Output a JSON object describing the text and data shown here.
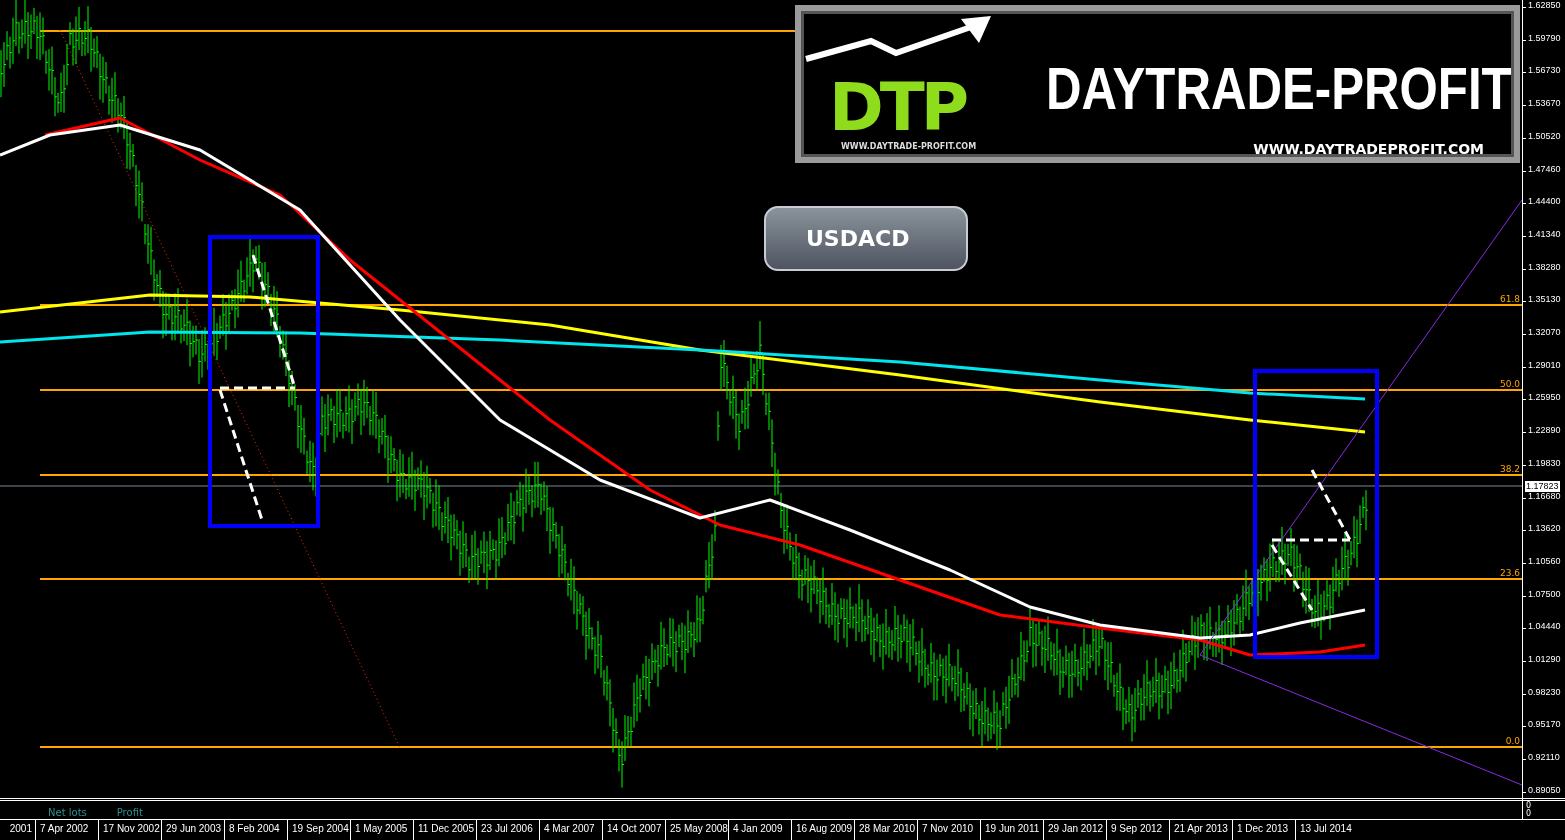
{
  "logo": {
    "monogram": "DTP",
    "brand": "DAYTRADE-PROFIT",
    "url_small": "WWW.DAYTRADE-PROFIT.COM",
    "url_large": "WWW.DAYTRADEPROFIT.COM"
  },
  "symbol_badge": "USDACD",
  "fib_levels": [
    {
      "label": "61.8"
    },
    {
      "label": "50.0"
    },
    {
      "label": "38.2"
    },
    {
      "label": "23.6"
    },
    {
      "label": "0.0"
    }
  ],
  "price_axis": {
    "ticks": [
      "1.62850",
      "1.59790",
      "1.56730",
      "1.53670",
      "1.50520",
      "1.47460",
      "1.44400",
      "1.41340",
      "1.38280",
      "1.35130",
      "1.32070",
      "1.29010",
      "1.25950",
      "1.22890",
      "1.19830",
      "1.16680",
      "1.13620",
      "1.10560",
      "1.07500",
      "1.04440",
      "1.01290",
      "0.98230",
      "0.95170",
      "0.92110",
      "0.89050"
    ],
    "current_price": "1.17823"
  },
  "indicator": {
    "labels": [
      "Net lots",
      "Profit"
    ],
    "values": [
      "0",
      "0"
    ]
  },
  "date_axis": [
    "2001",
    "7 Apr 2002",
    "17 Nov 2002",
    "29 Jun 2003",
    "8 Feb 2004",
    "19 Sep 2004",
    "1 May 2005",
    "11 Dec 2005",
    "23 Jul 2006",
    "4 Mar 2007",
    "14 Oct 2007",
    "25 May 2008",
    "4 Jan 2009",
    "16 Aug 2009",
    "28 Mar 2010",
    "7 Nov 2010",
    "19 Jun 2011",
    "29 Jan 2012",
    "9 Sep 2012",
    "21 Apr 2013",
    "1 Dec 2013",
    "13 Jul 2014"
  ]
}
